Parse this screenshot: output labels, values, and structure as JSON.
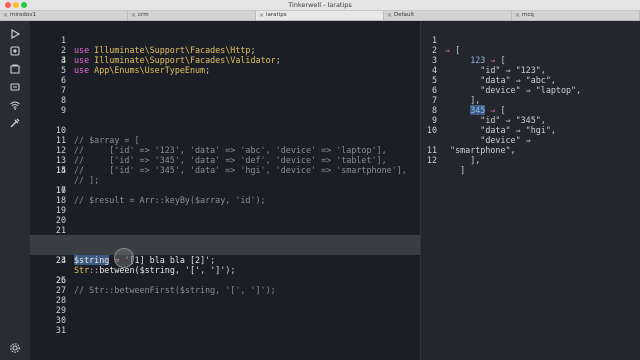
{
  "window": {
    "title": "Tinkerwell - laratips"
  },
  "tabs": [
    {
      "label": "mirodov1",
      "active": false
    },
    {
      "label": "crm",
      "active": false
    },
    {
      "label": "laratips",
      "active": true
    },
    {
      "label": "Default",
      "active": false
    },
    {
      "label": "mcq",
      "active": false
    }
  ],
  "sidebar": {
    "icons": [
      "play-icon",
      "tinker-icon",
      "snippets-icon",
      "connection-icon",
      "wifi-icon",
      "tools-icon",
      "settings-icon"
    ]
  },
  "colors": {
    "background": "#1c1e25",
    "keyword": "#e76bd8",
    "namespace": "#e0c05e",
    "comment": "#8a8d93",
    "arrow": "#e06c9f"
  },
  "editor": {
    "lines": [
      {
        "n": "1",
        "text": "use Illuminate\\Support\\Facades\\Http;"
      },
      {
        "n": "2",
        "text": "use Illuminate\\Support\\Facades\\Validator;"
      },
      {
        "n": "3",
        "text": "use App\\Enums\\UserTypeEnum;"
      },
      {
        "n": "4",
        "text": ""
      },
      {
        "n": "5",
        "text": ""
      },
      {
        "n": "6",
        "text": ""
      },
      {
        "n": "7",
        "text": ""
      },
      {
        "n": "8",
        "text": ""
      },
      {
        "n": "9",
        "text": ""
      },
      {
        "n": "10",
        "text": "// $array = ["
      },
      {
        "n": "11",
        "text": "//     ['id' => '123', 'data' => 'abc', 'device' => 'laptop'],"
      },
      {
        "n": "12",
        "text": "//     ['id' => '345', 'data' => 'def', 'device' => 'tablet'],"
      },
      {
        "n": "13",
        "text": "//     ['id' => '345', 'data' => 'hgi', 'device' => 'smartphone'],"
      },
      {
        "n": "14",
        "text": "// ];"
      },
      {
        "n": "15",
        "text": ""
      },
      {
        "n": "16",
        "text": "// $result = Arr::keyBy($array, 'id');"
      },
      {
        "n": "17",
        "text": ""
      },
      {
        "n": "18",
        "text": ""
      },
      {
        "n": "19",
        "text": ""
      },
      {
        "n": "20",
        "text": ""
      },
      {
        "n": "21",
        "text": ""
      },
      {
        "n": "22",
        "text": "$string = '[1] bla bla [2]';"
      },
      {
        "n": "23",
        "text": "Str::between($string, '[', ']');"
      },
      {
        "n": "24",
        "text": ""
      },
      {
        "n": "25",
        "text": "// Str::betweenFirst($string, '[', ']');"
      },
      {
        "n": "26",
        "text": ""
      },
      {
        "n": "27",
        "text": ""
      },
      {
        "n": "28",
        "text": ""
      },
      {
        "n": "29",
        "text": ""
      },
      {
        "n": "30",
        "text": ""
      },
      {
        "n": "31",
        "text": ""
      }
    ]
  },
  "output": {
    "lines": [
      {
        "n": "1",
        "text": "⇒ ["
      },
      {
        "n": "2",
        "text": "     123 ⇒ ["
      },
      {
        "n": "3",
        "text": "       \"id\" ⇒ \"123\","
      },
      {
        "n": "4",
        "text": "       \"data\" ⇒ \"abc\","
      },
      {
        "n": "5",
        "text": "       \"device\" ⇒ \"laptop\","
      },
      {
        "n": "6",
        "text": "     ],"
      },
      {
        "n": "7",
        "text": "     345 ⇒ ["
      },
      {
        "n": "8",
        "text": "       \"id\" ⇒ \"345\","
      },
      {
        "n": "9",
        "text": "       \"data\" ⇒ \"hgi\","
      },
      {
        "n": "10",
        "text": "       \"device\" ⇒"
      },
      {
        "n": "",
        "text": " \"smartphone\","
      },
      {
        "n": "11",
        "text": "     ],"
      },
      {
        "n": "12",
        "text": "   ]"
      }
    ]
  }
}
